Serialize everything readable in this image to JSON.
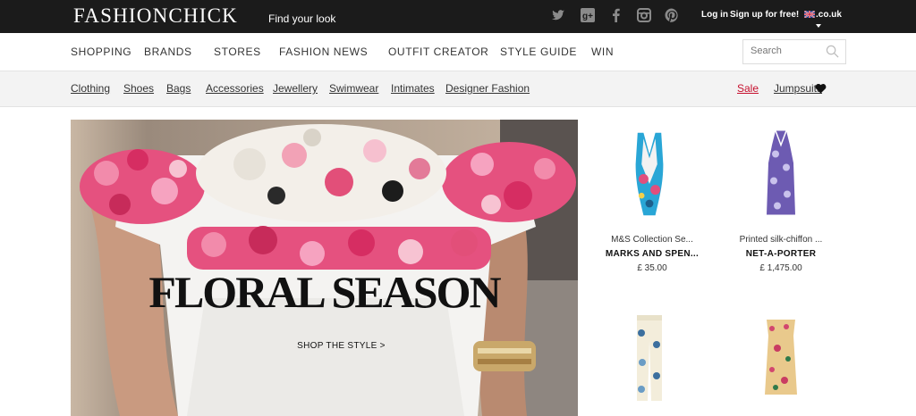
{
  "brand": {
    "logo": "FASHIONCHICK",
    "tagline": "Find your look"
  },
  "social": [
    "twitter-icon",
    "google-plus-icon",
    "facebook-icon",
    "instagram-icon",
    "pinterest-icon"
  ],
  "account": {
    "login": "Log in",
    "signup": "Sign up for free!",
    "region": ".co.uk"
  },
  "main_nav": [
    "SHOPPING",
    "BRANDS",
    "STORES",
    "FASHION NEWS",
    "OUTFIT CREATOR",
    "STYLE GUIDE",
    "WIN"
  ],
  "search": {
    "placeholder": "Search"
  },
  "sub_nav": [
    "Clothing",
    "Shoes",
    "Bags",
    "Accessories",
    "Jewellery",
    "Swimwear",
    "Intimates",
    "Designer Fashion"
  ],
  "sub_nav_right": {
    "sale": "Sale",
    "jumpsuits": "Jumpsuits"
  },
  "hero": {
    "title": "FLORAL SEASON",
    "cta": "SHOP THE STYLE >"
  },
  "products": [
    {
      "name": "M&S Collection Se...",
      "store": "MARKS AND SPEN...",
      "price": "£ 35.00"
    },
    {
      "name": "Printed silk-chiffon ...",
      "store": "NET-A-PORTER",
      "price": "£ 1,475.00"
    },
    {
      "name": "",
      "store": "",
      "price": ""
    },
    {
      "name": "",
      "store": "",
      "price": ""
    }
  ],
  "colors": {
    "topbar": "#1b1b1b",
    "sale": "#c6102e",
    "subnav_bg": "#f3f3f3"
  }
}
